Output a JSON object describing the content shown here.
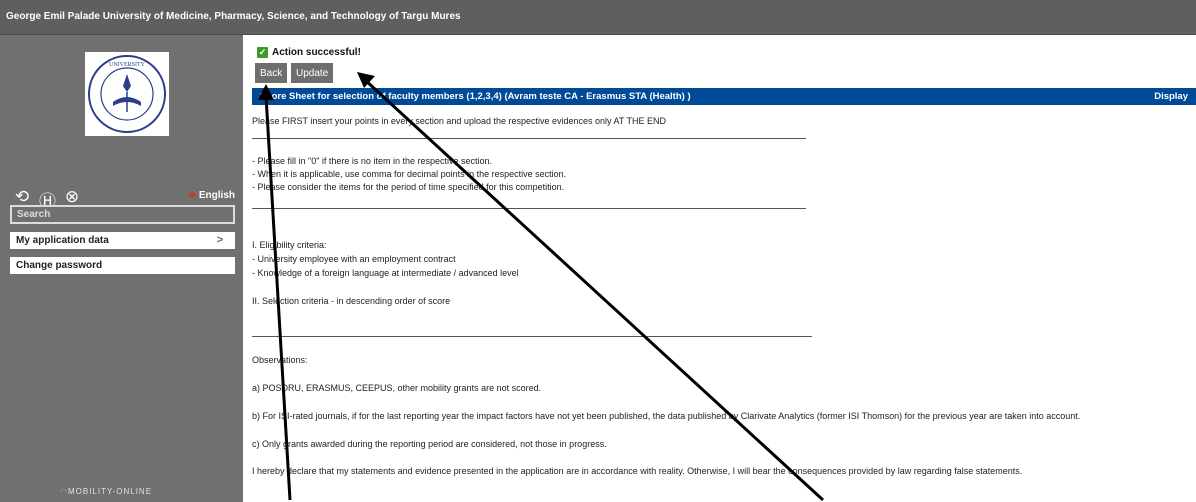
{
  "topbar": {
    "title": "George Emil Palade University of Medicine, Pharmacy, Science, and Technology of Targu Mures"
  },
  "sidebar": {
    "logo_text": "UNIVERSITY",
    "icons": [
      "refresh-icon",
      "help-icon",
      "close-icon"
    ],
    "language": "English",
    "search_placeholder": "Search",
    "items": [
      {
        "label": "My application data",
        "chevron": ">"
      },
      {
        "label": "Change password"
      }
    ],
    "footer_logo": "MOBILITY-ONLINE"
  },
  "main": {
    "status": "Action successful!",
    "buttons": {
      "back": "Back",
      "update": "Update"
    },
    "header": {
      "title": "Score Sheet for selection of faculty members (1,2,3,4) (Avram teste CA - Erasmus STA (Health) )",
      "right_label": "Display"
    },
    "intro": "Please FIRST insert your points in every section and upload the respective evidences only AT THE END",
    "notes": [
      "- Please fill in \"0\" if there is no item in the respective section.",
      "- When it is applicable, use comma for decimal points in the respective section.",
      "- Please consider the items for the period of time specified for this competition."
    ],
    "eligibility": [
      "I. Eligibility criteria:",
      "- University employee with an employment contract",
      "- Knowledge of a foreign language at intermediate / advanced level"
    ],
    "selection": "II. Selection criteria - in descending order of score",
    "observations_title": "Observations:",
    "observations": [
      "a) POSDRU, ERASMUS, CEEPUS, other mobility grants are not scored.",
      "b) For ISI-rated journals, if for the last reporting year the impact factors have not yet been published, the data published by Clarivate Analytics (former ISI Thomson) for the previous year are taken into account.",
      "c) Only grants awarded during the reporting period are considered, not those in progress."
    ],
    "declaration": "I hereby declare that my statements and evidence presented in the application are in accordance with reality. Otherwise, I will bear the consequences provided by law regarding false statements."
  },
  "colors": {
    "header_blue": "#004a98",
    "sidebar_gray": "#707070",
    "success_green": "#3a9a2a"
  }
}
